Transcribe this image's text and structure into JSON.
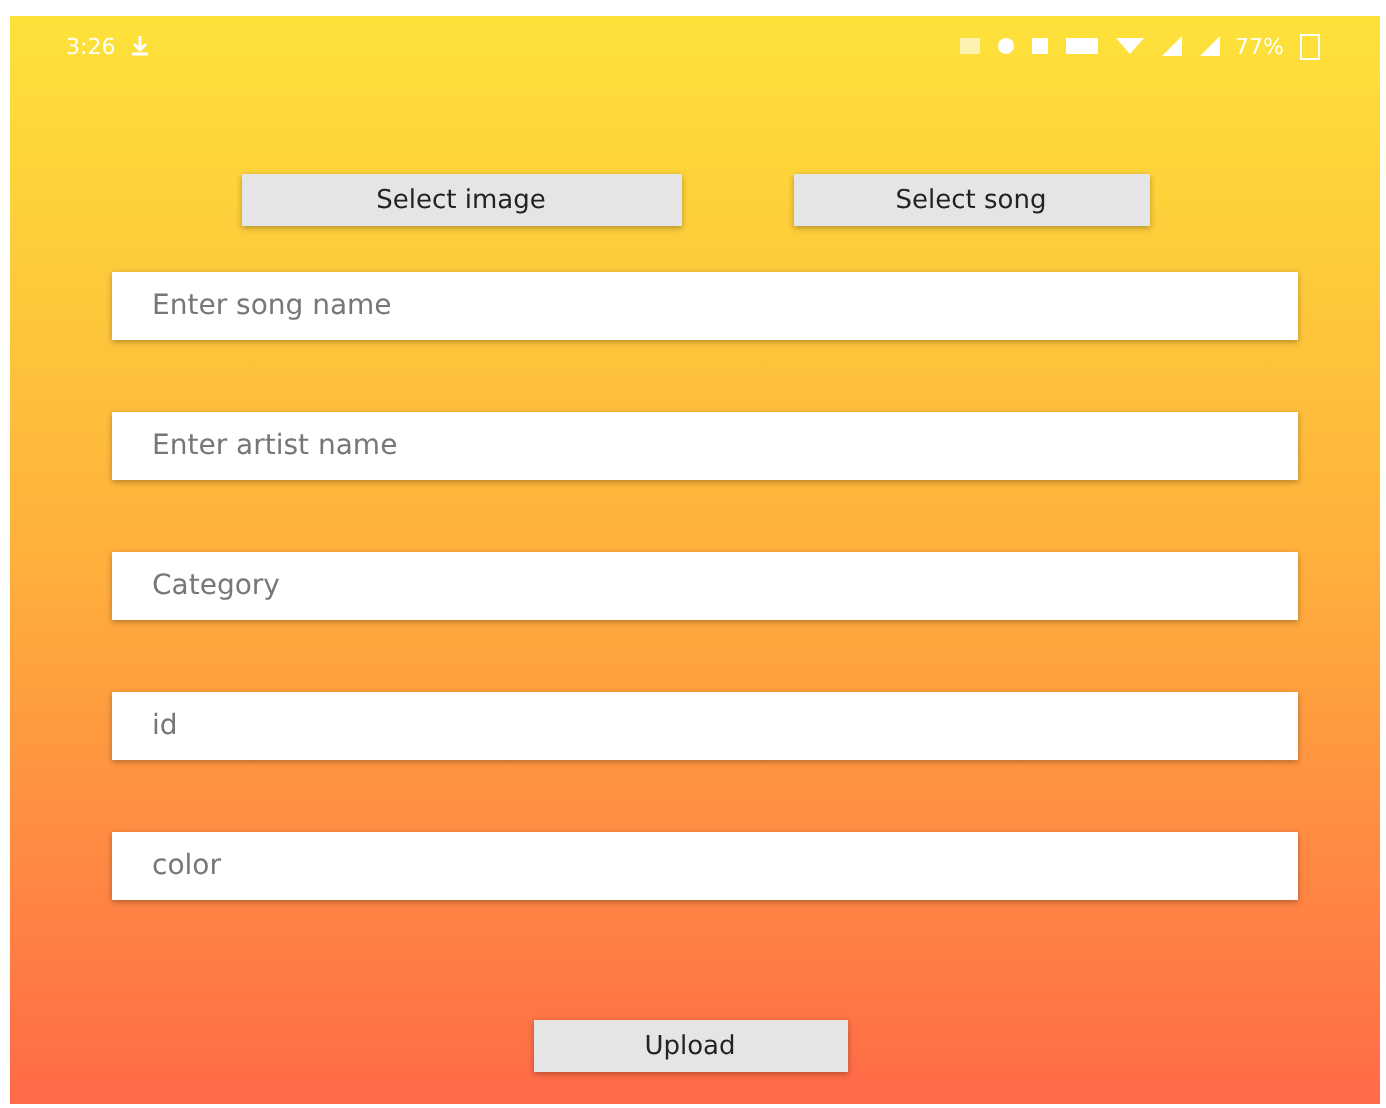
{
  "status_bar": {
    "time": "3:26",
    "battery": "77%"
  },
  "buttons": [
    {
      "label": "Select image"
    },
    {
      "label": "Select song"
    }
  ],
  "fields": [
    {
      "placeholder": "Enter song name"
    },
    {
      "placeholder": "Enter artist name"
    },
    {
      "placeholder": "Category"
    },
    {
      "placeholder": "id"
    },
    {
      "placeholder": "color"
    }
  ],
  "upload_button": {
    "label": "Upload"
  }
}
